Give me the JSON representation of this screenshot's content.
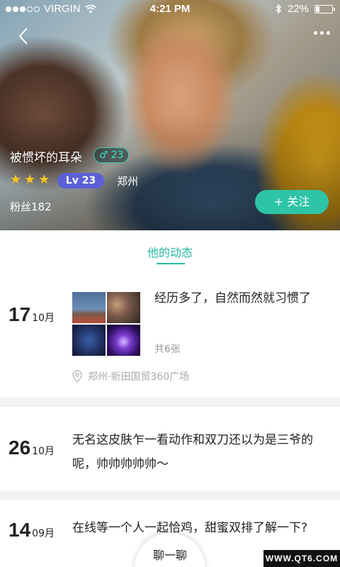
{
  "status_bar": {
    "carrier": "VIRGIN",
    "time": "4:21 PM",
    "battery": "22%",
    "battery_level": 0.22,
    "icons": [
      "signal-dots-icon",
      "wifi-icon",
      "bluetooth-icon",
      "battery-icon"
    ]
  },
  "profile": {
    "name": "被惯坏的耳朵",
    "gender_symbol": "♂",
    "age": "23",
    "stars": 3,
    "level": "Lv 23",
    "location": "郑州",
    "fans": "粉丝182",
    "follow_button": "+ 关注"
  },
  "tabs": {
    "active": "他的动态"
  },
  "posts": [
    {
      "day": "17",
      "month": "10月",
      "text": "经历多了，自然而然就习惯了",
      "photo_count": "共6张",
      "location": "郑州·新田国贸360广场"
    },
    {
      "day": "26",
      "month": "10月",
      "text": "无名这皮肤乍一看动作和双刀还以为是三爷的呢，帅帅帅帅帅～"
    },
    {
      "day": "14",
      "month": "09月",
      "text": "在线等一个人一起恰鸡，甜蜜双排了解一下?"
    }
  ],
  "chat_button": "聊一聊",
  "watermark": "WWW.QT6.COM",
  "colors": {
    "accent": "#2ec4a6",
    "level_badge": "#5d60d6",
    "star": "#f6c51b"
  }
}
